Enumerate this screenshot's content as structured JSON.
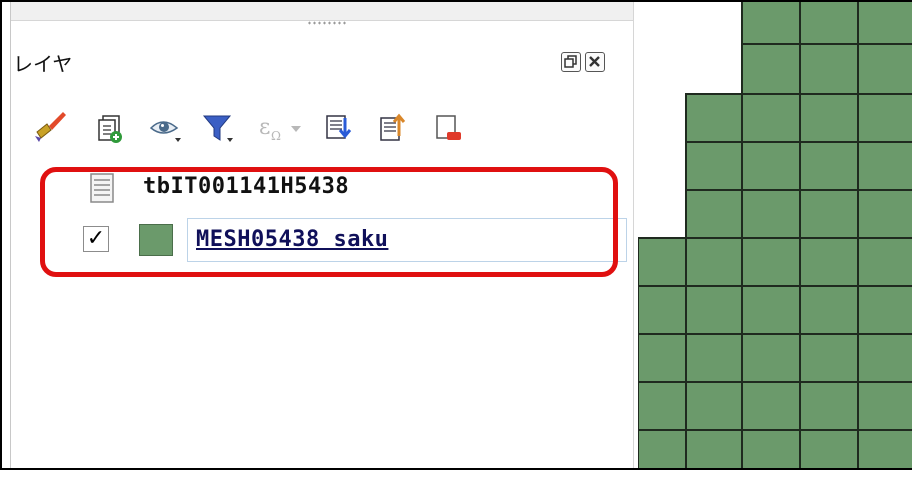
{
  "panel": {
    "title": "レイヤ",
    "title_buttons": [
      "float-icon",
      "close-icon"
    ]
  },
  "toolbar": {
    "icons": [
      "style-manager-icon",
      "add-group-icon",
      "visibility-icon",
      "filter-legend-icon",
      "expression-filter-icon",
      "expand-all-icon",
      "collapse-all-icon",
      "remove-layer-icon"
    ]
  },
  "layers": [
    {
      "name": "tbIT001141H5438",
      "icon": "table-icon",
      "checkable": false
    },
    {
      "name": "MESH05438 saku",
      "icon": "polygon-swatch",
      "checked": true,
      "check_mark": "✓",
      "swatch_color": "#6b9a6b",
      "editing": true
    }
  ],
  "colors": {
    "highlight": "#e01010",
    "mesh_fill": "#6b9a6b",
    "mesh_stroke": "#1f2a1f"
  }
}
